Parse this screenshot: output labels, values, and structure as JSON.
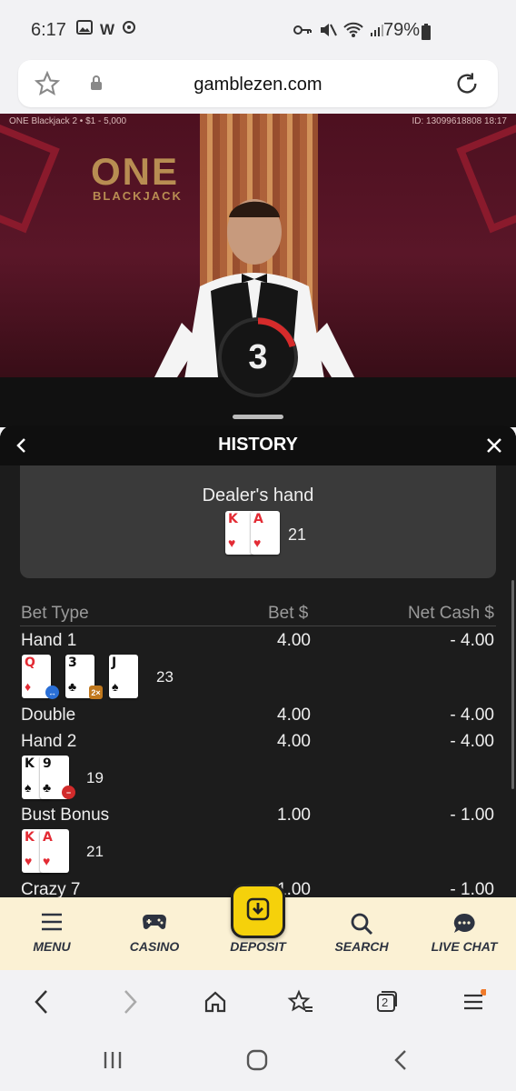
{
  "status_bar": {
    "time": "6:17",
    "battery": "79%",
    "left_icons": [
      "image-icon",
      "w-icon",
      "settings-icon"
    ],
    "right_icons": [
      "key-icon",
      "mute-icon",
      "wifi-icon",
      "signal-icon",
      "battery-icon"
    ]
  },
  "browser": {
    "url": "gamblezen.com",
    "tabs_count": "2"
  },
  "stream": {
    "table_info": "ONE Blackjack 2 • $1 - 5,000",
    "round_id": "ID: 13099618808 18:17",
    "logo_top": "ONE",
    "logo_bottom": "BLACKJACK",
    "timer": "3"
  },
  "history": {
    "title": "HISTORY",
    "dealer_label": "Dealer's hand",
    "dealer_cards": [
      {
        "rank": "K",
        "suit": "♥",
        "color": "red"
      },
      {
        "rank": "A",
        "suit": "♥",
        "color": "red"
      }
    ],
    "dealer_total": "21",
    "columns": {
      "bet_type": "Bet Type",
      "bet": "Bet $",
      "net": "Net Cash $"
    },
    "rows": [
      {
        "label": "Hand 1",
        "bet": "4.00",
        "net": "- 4.00"
      },
      {
        "label": "Double",
        "bet": "4.00",
        "net": "- 4.00"
      },
      {
        "label": "Hand 2",
        "bet": "4.00",
        "net": "- 4.00"
      },
      {
        "label": "Bust Bonus",
        "bet": "1.00",
        "net": "- 1.00"
      },
      {
        "label": "Crazy 7",
        "bet": "1.00",
        "net": "- 1.00"
      }
    ],
    "hand1_cards": [
      {
        "rank": "Q",
        "suit": "♦",
        "color": "red"
      },
      {
        "rank": "3",
        "suit": "♣",
        "color": "black"
      },
      {
        "rank": "J",
        "suit": "♠",
        "color": "black"
      }
    ],
    "hand1_total": "23",
    "hand2_cards": [
      {
        "rank": "K",
        "suit": "♠",
        "color": "black"
      },
      {
        "rank": "9",
        "suit": "♣",
        "color": "black"
      }
    ],
    "hand2_total": "19",
    "bust_cards": [
      {
        "rank": "K",
        "suit": "♥",
        "color": "red"
      },
      {
        "rank": "A",
        "suit": "♥",
        "color": "red"
      }
    ],
    "bust_total": "21",
    "badges": {
      "double": "2×"
    }
  },
  "bottom_nav": {
    "menu": "MENU",
    "casino": "CASINO",
    "deposit": "DEPOSIT",
    "search": "SEARCH",
    "live_chat": "LIVE CHAT"
  },
  "colors": {
    "accent_yellow": "#f5d10b",
    "nav_bg": "#fbf1d4",
    "panel_bg": "#1c1c1c",
    "card_red": "#e32b34"
  }
}
